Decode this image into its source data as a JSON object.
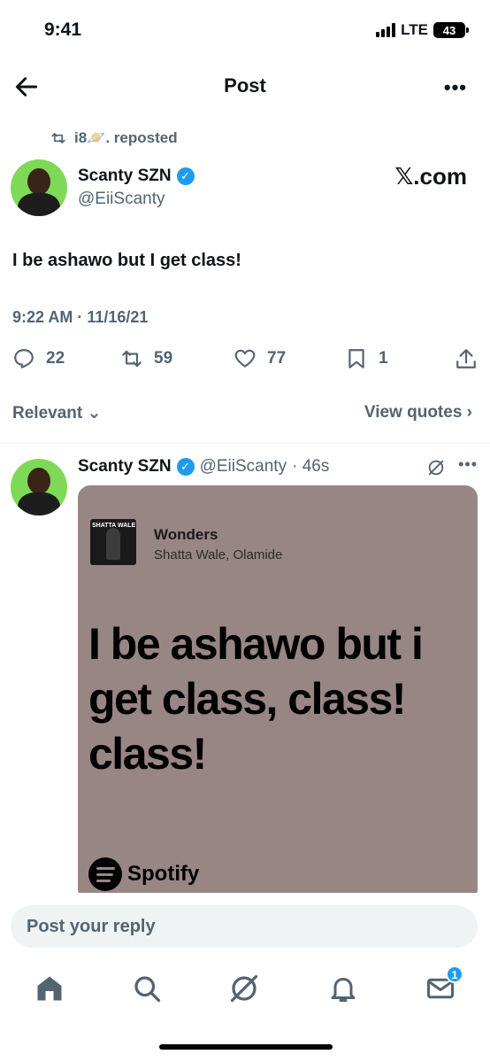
{
  "status_bar": {
    "time": "9:41",
    "network": "LTE",
    "battery": "43"
  },
  "header": {
    "title": "Post"
  },
  "repost": {
    "text": "i8🪐. reposted"
  },
  "post": {
    "author_name": "Scanty SZN",
    "handle": "@EiiScanty",
    "source_badge": "𝕏.com",
    "text": "I be ashawo but I get class!",
    "timestamp": "9:22 AM · 11/16/21",
    "replies": "22",
    "reposts": "59",
    "likes": "77",
    "bookmarks": "1"
  },
  "sort": {
    "label": "Relevant",
    "view_quotes": "View quotes"
  },
  "reply": {
    "author_name": "Scanty SZN",
    "handle": "@EiiScanty",
    "time": "· 46s",
    "card": {
      "album_text": "SHATTA WALE",
      "song_title": "Wonders",
      "artists": "Shatta Wale, Olamide",
      "lyric": "I be ashawo but i get class, class! class!",
      "brand": "Spotify"
    }
  },
  "reply_bar": {
    "placeholder": "Post your reply"
  },
  "nav": {
    "messages_badge": "1"
  },
  "colors": {
    "accent": "#1d9bf0",
    "secondary_text": "#536471",
    "card_bg": "#988685",
    "avatar_bg": "#7ed957"
  }
}
